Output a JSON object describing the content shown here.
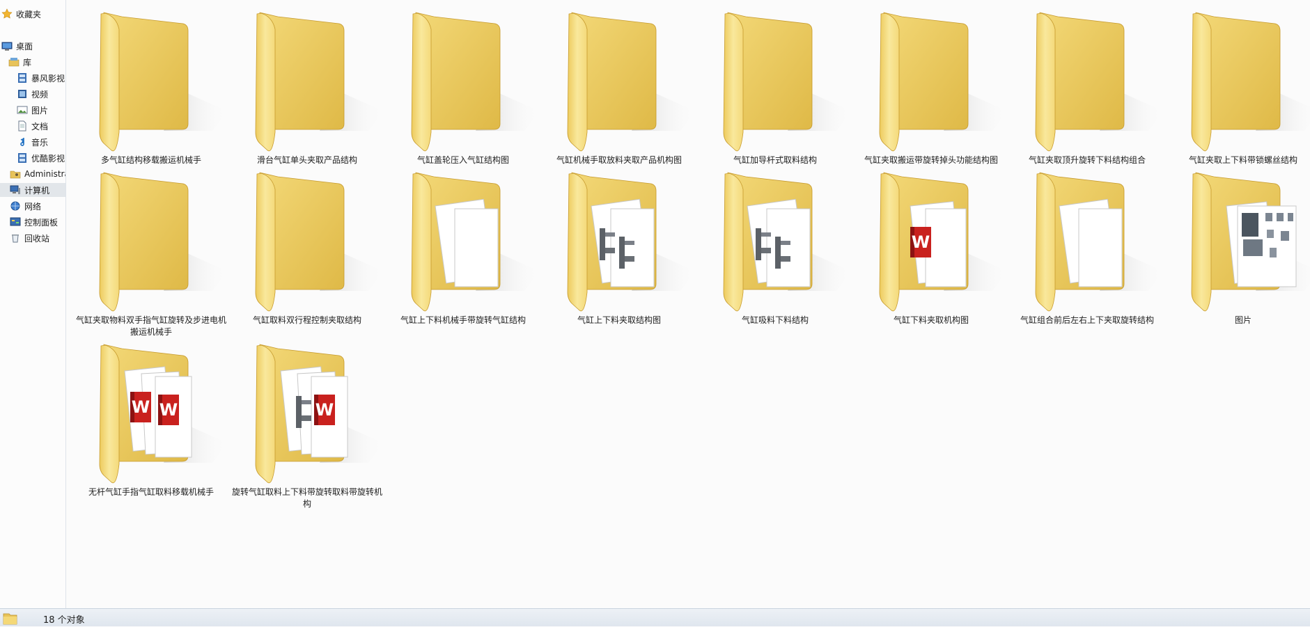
{
  "sidebar": {
    "items": [
      {
        "label": "收藏夹",
        "icon": "star-icon"
      },
      {
        "label": "桌面",
        "icon": "desktop-icon"
      },
      {
        "label": "库",
        "icon": "library-icon"
      },
      {
        "label": "暴风影视",
        "icon": "video-library-icon"
      },
      {
        "label": "视频",
        "icon": "video-icon"
      },
      {
        "label": "图片",
        "icon": "picture-icon"
      },
      {
        "label": "文档",
        "icon": "document-icon"
      },
      {
        "label": "音乐",
        "icon": "music-icon"
      },
      {
        "label": "优酷影视",
        "icon": "video-library-icon"
      },
      {
        "label": "Administrator",
        "icon": "user-folder-icon"
      },
      {
        "label": "计算机",
        "icon": "computer-icon"
      },
      {
        "label": "网络",
        "icon": "network-icon"
      },
      {
        "label": "控制面板",
        "icon": "control-panel-icon"
      },
      {
        "label": "回收站",
        "icon": "recycle-bin-icon"
      }
    ]
  },
  "folders": [
    {
      "name": "多气缸结构移载搬运机械手",
      "preview": "empty"
    },
    {
      "name": "滑台气缸单头夹取产品结构",
      "preview": "empty"
    },
    {
      "name": "气缸盖轮压入气缸结构图",
      "preview": "empty"
    },
    {
      "name": "气缸机械手取放料夹取产品机构图",
      "preview": "empty"
    },
    {
      "name": "气缸加导杆式取料结构",
      "preview": "empty"
    },
    {
      "name": "气缸夹取搬运带旋转掉头功能结构图",
      "preview": "empty"
    },
    {
      "name": "气缸夹取顶升旋转下料结构组合",
      "preview": "empty"
    },
    {
      "name": "气缸夹取上下料带锁螺丝结构",
      "preview": "empty"
    },
    {
      "name": "气缸夹取物料双手指气缸旋转及步进电机搬运机械手",
      "preview": "empty"
    },
    {
      "name": "气缸取料双行程控制夹取结构",
      "preview": "empty"
    },
    {
      "name": "气缸上下料机械手带旋转气缸结构",
      "preview": "papers"
    },
    {
      "name": "气缸上下料夹取结构图",
      "preview": "papers-part"
    },
    {
      "name": "气缸吸料下料结构",
      "preview": "papers-part"
    },
    {
      "name": "气缸下料夹取机构图",
      "preview": "papers-w"
    },
    {
      "name": "气缸组合前后左右上下夹取旋转结构",
      "preview": "papers"
    },
    {
      "name": "图片",
      "preview": "photos"
    },
    {
      "name": "无杆气缸手指气缸取料移载机械手",
      "preview": "papers-ww"
    },
    {
      "name": "旋转气缸取料上下料带旋转取料带旋转机构",
      "preview": "papers-w-part"
    }
  ],
  "status": {
    "count": "18 个对象"
  }
}
